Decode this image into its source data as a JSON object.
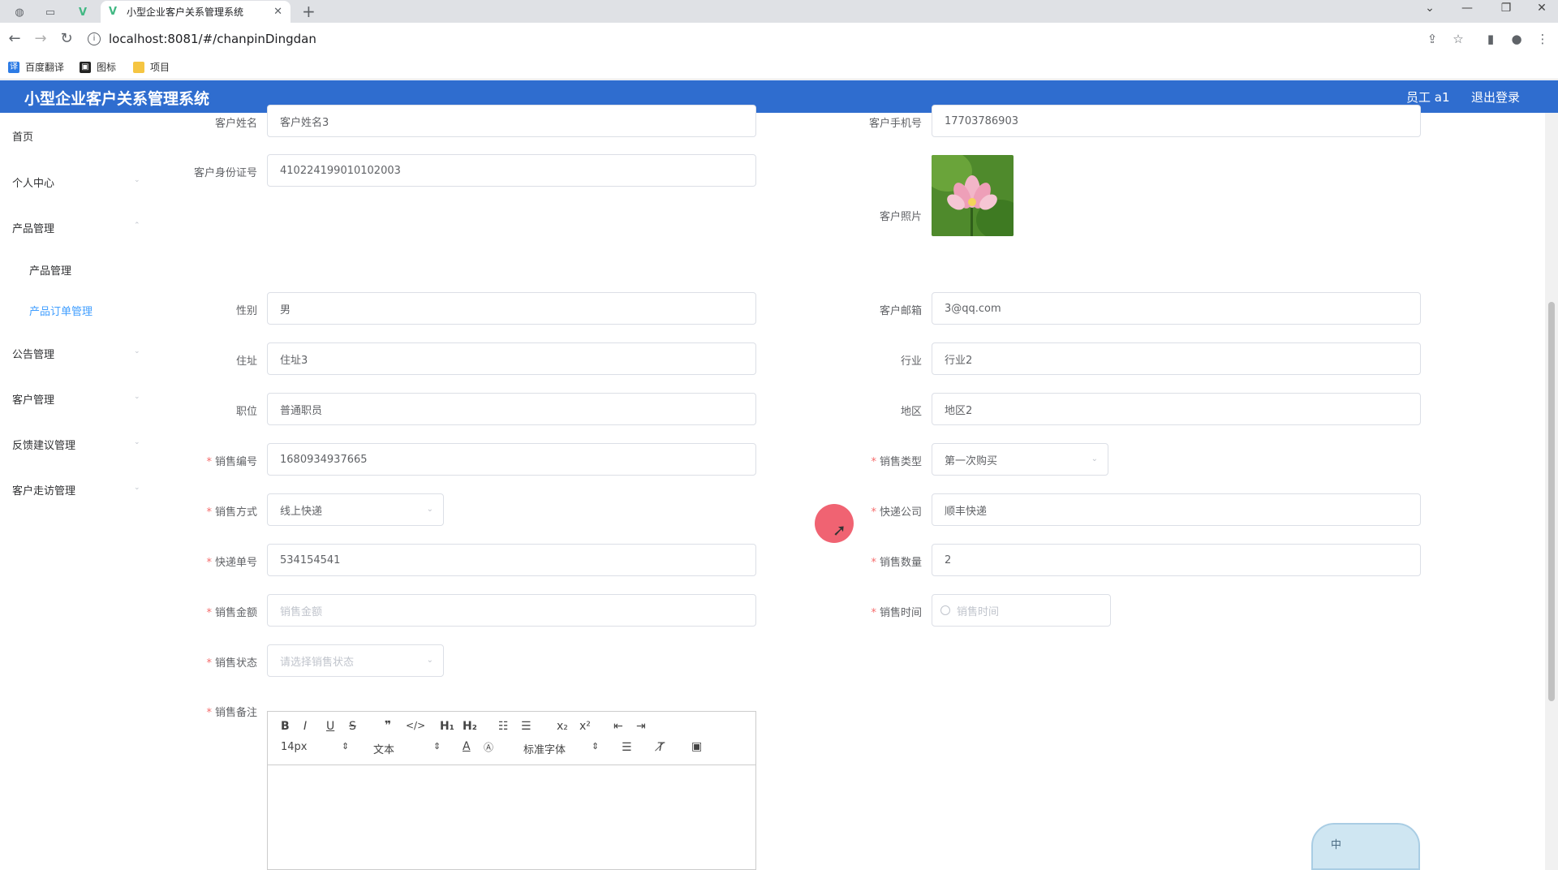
{
  "browser": {
    "tab_title": "小型企业客户关系管理系统",
    "url": "localhost:8081/#/chanpinDingdan",
    "bookmarks": [
      "百度翻译",
      "图标",
      "项目"
    ]
  },
  "header": {
    "title": "小型企业客户关系管理系统",
    "user": "员工 a1",
    "logout": "退出登录",
    "color": "#2f6dcf"
  },
  "sidebar": {
    "items": [
      {
        "label": "首页"
      },
      {
        "label": "个人中心"
      },
      {
        "label": "产品管理"
      },
      {
        "label": "产品管理"
      },
      {
        "label": "产品订单管理"
      },
      {
        "label": "公告管理"
      },
      {
        "label": "客户管理"
      },
      {
        "label": "反馈建议管理"
      },
      {
        "label": "客户走访管理"
      }
    ]
  },
  "form": {
    "customer_name": {
      "label": "客户姓名",
      "value": "客户姓名3"
    },
    "customer_phone": {
      "label": "客户手机号",
      "value": "17703786903"
    },
    "customer_id": {
      "label": "客户身份证号",
      "value": "410224199010102003"
    },
    "customer_photo": {
      "label": "客户照片"
    },
    "gender": {
      "label": "性别",
      "value": "男"
    },
    "email": {
      "label": "客户邮箱",
      "value": "3@qq.com"
    },
    "address": {
      "label": "住址",
      "value": "住址3"
    },
    "industry": {
      "label": "行业",
      "value": "行业2"
    },
    "position": {
      "label": "职位",
      "value": "普通职员"
    },
    "region": {
      "label": "地区",
      "value": "地区2"
    },
    "sale_no": {
      "label": "销售编号",
      "value": "1680934937665"
    },
    "sale_type": {
      "label": "销售类型",
      "value": "第一次购买"
    },
    "sale_method": {
      "label": "销售方式",
      "value": "线上快递"
    },
    "courier": {
      "label": "快递公司",
      "value": "顺丰快递"
    },
    "tracking_no": {
      "label": "快递单号",
      "value": "534154541"
    },
    "sale_qty": {
      "label": "销售数量",
      "value": "2"
    },
    "sale_amount": {
      "label": "销售金额",
      "placeholder": "销售金额"
    },
    "sale_time": {
      "label": "销售时间",
      "placeholder": "销售时间"
    },
    "sale_status": {
      "label": "销售状态",
      "placeholder": "请选择销售状态"
    },
    "sale_remark": {
      "label": "销售备注"
    }
  },
  "editor": {
    "font_size": "14px",
    "text_style": "文本",
    "font_family": "标准字体"
  },
  "ime": {
    "label": "中"
  }
}
